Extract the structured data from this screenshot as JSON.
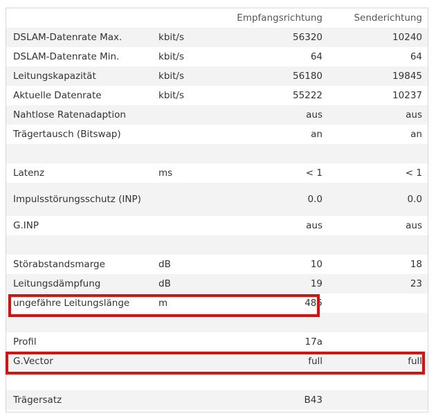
{
  "header": {
    "col_downstream": "Empfangsrichtung",
    "col_upstream": "Senderichtung"
  },
  "rows": [
    {
      "label": "DSLAM-Datenrate Max.",
      "unit": "kbit/s",
      "down": "56320",
      "up": "10240"
    },
    {
      "label": "DSLAM-Datenrate Min.",
      "unit": "kbit/s",
      "down": "64",
      "up": "64"
    },
    {
      "label": "Leitungskapazität",
      "unit": "kbit/s",
      "down": "56180",
      "up": "19845"
    },
    {
      "label": "Aktuelle Datenrate",
      "unit": "kbit/s",
      "down": "55222",
      "up": "10237"
    },
    {
      "label": "Nahtlose Ratenadaption",
      "unit": "",
      "down": "aus",
      "up": "aus"
    },
    {
      "label": "Trägertausch (Bitswap)",
      "unit": "",
      "down": "an",
      "up": "an"
    },
    {
      "label": "",
      "unit": "",
      "down": "",
      "up": ""
    },
    {
      "label": "Latenz",
      "unit": "ms",
      "down": "< 1",
      "up": "< 1"
    },
    {
      "label": "Impulsstörungsschutz (INP)",
      "unit": "",
      "down": "0.0",
      "up": "0.0"
    },
    {
      "label": "G.INP",
      "unit": "",
      "down": "aus",
      "up": "aus"
    },
    {
      "label": "",
      "unit": "",
      "down": "",
      "up": ""
    },
    {
      "label": "Störabstandsmarge",
      "unit": "dB",
      "down": "10",
      "up": "18"
    },
    {
      "label": "Leitungsdämpfung",
      "unit": "dB",
      "down": "19",
      "up": "23"
    },
    {
      "label": "ungefähre Leitungslänge",
      "unit": "m",
      "down": "485",
      "up": ""
    },
    {
      "label": "",
      "unit": "",
      "down": "",
      "up": ""
    },
    {
      "label": "Profil",
      "unit": "",
      "down": "17a",
      "up": ""
    },
    {
      "label": "G.Vector",
      "unit": "",
      "down": "full",
      "up": "full"
    },
    {
      "label": "",
      "unit": "",
      "down": "",
      "up": ""
    },
    {
      "label": "Trägersatz",
      "unit": "",
      "down": "B43",
      "up": ""
    }
  ],
  "highlight_color": "#e10e0e"
}
